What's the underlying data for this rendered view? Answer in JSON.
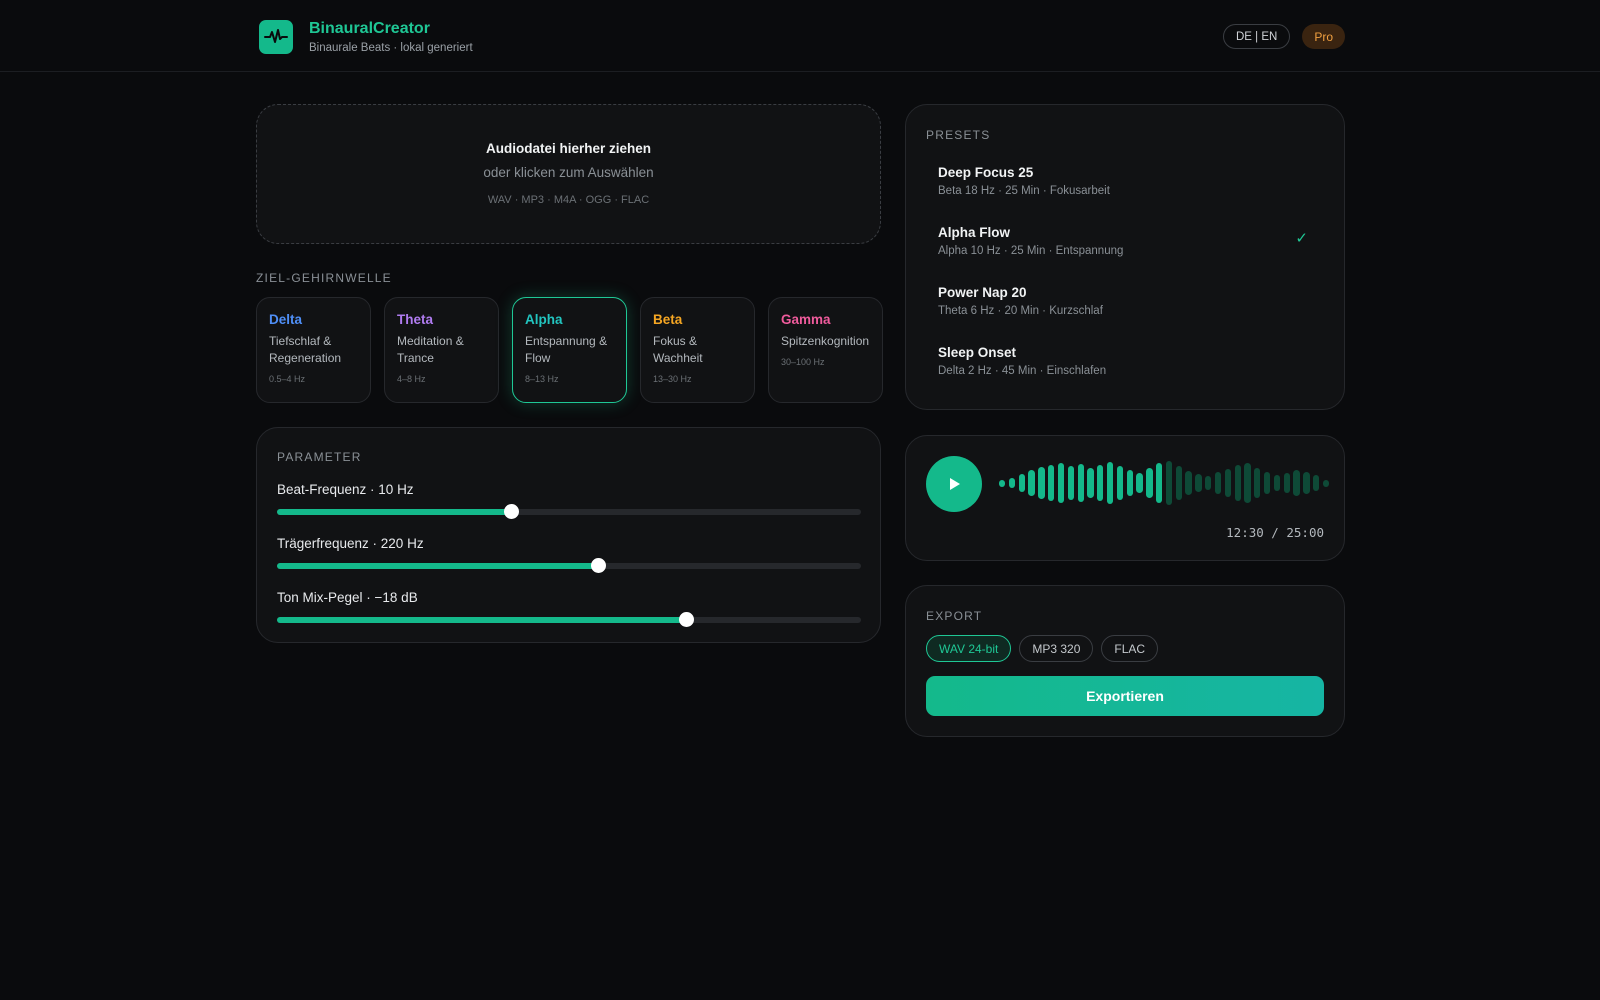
{
  "app": {
    "title": "BinauralCreator",
    "subtitle": "Binaurale Beats · lokal generiert",
    "logo_icon": "pulse-icon",
    "lang_toggle": "DE | EN",
    "plan_badge": "Pro"
  },
  "colors": {
    "accent": "#14b98b",
    "accent_text": "#1fc795",
    "background": "#0a0b0d",
    "card": "#111214",
    "delta": "#4f8ff7",
    "theta": "#b07cf0",
    "alpha": "#22c5c0",
    "beta": "#f5a623",
    "gamma": "#ef5b9c"
  },
  "dropzone": {
    "title": "Audiodatei hierher ziehen",
    "subtitle": "oder klicken zum Auswählen",
    "formats": "WAV · MP3 · M4A · OGG · FLAC"
  },
  "brainwave": {
    "label": "ZIEL-GEHIRNWELLE",
    "selected": "Alpha",
    "options": [
      {
        "name": "Delta",
        "desc": "Tiefschlaf & Regeneration",
        "range": "0.5–4 Hz"
      },
      {
        "name": "Theta",
        "desc": "Meditation & Trance",
        "range": "4–8 Hz"
      },
      {
        "name": "Alpha",
        "desc": "Entspannung & Flow",
        "range": "8–13 Hz"
      },
      {
        "name": "Beta",
        "desc": "Fokus & Wachheit",
        "range": "13–30 Hz"
      },
      {
        "name": "Gamma",
        "desc": "Spitzenkognition",
        "range": "30–100 Hz"
      }
    ]
  },
  "parameters": {
    "label": "PARAMETER",
    "sliders": [
      {
        "label": "Beat-Frequenz · 10 Hz",
        "level": 0.4
      },
      {
        "label": "Trägerfrequenz · 220 Hz",
        "level": 0.55
      },
      {
        "label": "Ton Mix-Pegel · −18 dB",
        "level": 0.7
      }
    ]
  },
  "presets": {
    "label": "PRESETS",
    "selected": "Alpha Flow",
    "items": [
      {
        "name": "Deep Focus 25",
        "meta": "Beta 18 Hz · 25 Min · Fokusarbeit"
      },
      {
        "name": "Alpha Flow",
        "meta": "Alpha 10 Hz · 25 Min · Entspannung"
      },
      {
        "name": "Power Nap 20",
        "meta": "Theta 6 Hz · 20 Min · Kurzschlaf"
      },
      {
        "name": "Sleep Onset",
        "meta": "Delta 2 Hz · 45 Min · Einschlafen"
      }
    ],
    "check_icon": "checkmark-icon"
  },
  "player": {
    "play_icon": "play-icon",
    "time": "12:30 / 25:00",
    "progress": 0.5
  },
  "export": {
    "label": "EXPORT",
    "selected_format": "WAV 24-bit",
    "formats": [
      "WAV 24-bit",
      "MP3 320",
      "FLAC"
    ],
    "button_label": "Exportieren"
  }
}
